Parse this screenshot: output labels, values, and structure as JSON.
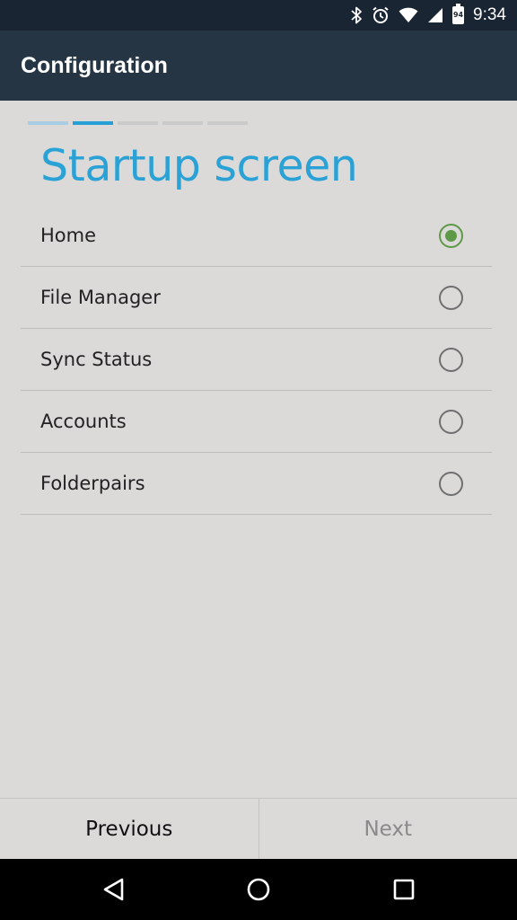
{
  "status_bar": {
    "time": "9:34",
    "battery_level": "94",
    "icons": [
      "bluetooth-icon",
      "alarm-icon",
      "wifi-icon",
      "cell-signal-icon",
      "battery-icon"
    ]
  },
  "app_bar": {
    "title": "Configuration"
  },
  "wizard": {
    "steps_total": 5,
    "current_step": 2,
    "title": "Startup screen",
    "options": [
      {
        "label": "Home",
        "selected": true
      },
      {
        "label": "File Manager",
        "selected": false
      },
      {
        "label": "Sync Status",
        "selected": false
      },
      {
        "label": "Accounts",
        "selected": false
      },
      {
        "label": "Folderpairs",
        "selected": false
      }
    ]
  },
  "buttons": {
    "previous_label": "Previous",
    "next_label": "Next"
  },
  "colors": {
    "accent": "#2aa2d6",
    "radio_selected": "#5d9946",
    "app_bar": "#263544",
    "status_bar": "#1a2533",
    "background": "#dcd9d9"
  },
  "nav_bar": {
    "icons": [
      "back-icon",
      "home-icon",
      "recents-icon"
    ]
  }
}
